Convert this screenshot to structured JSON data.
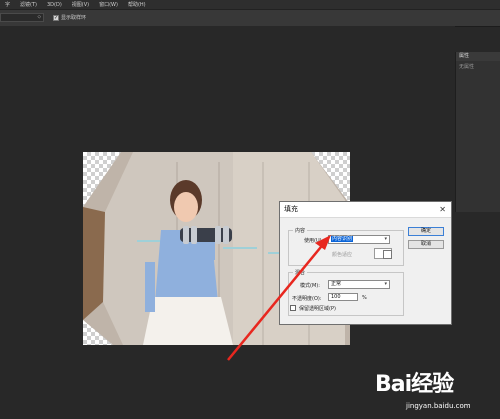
{
  "menu": [
    "字",
    "滤镜(T)",
    "3D(D)",
    "视图(V)",
    "窗口(W)",
    "帮助(H)"
  ],
  "options": {
    "show_sampling_ring": "显示取样环"
  },
  "panel": {
    "title": "属性",
    "subtitle": "无属性"
  },
  "dialog": {
    "title": "填充",
    "content_group": "内容",
    "use_label": "使用(U):",
    "use_value": "内容识别",
    "color_adapt_label": "颜色适应",
    "blend_group": "混合",
    "mode_label": "模式(M):",
    "mode_value": "正常",
    "opacity_label": "不透明度(O):",
    "opacity_value": "100",
    "opacity_unit": "%",
    "preserve_label": "保留透明区域(P)",
    "ok": "确定",
    "cancel": "取消"
  },
  "watermark": {
    "brand": "Bai经验",
    "url": "jingyan.baidu.com"
  },
  "colors": {
    "background": "#282828",
    "arrow": "#e8271f",
    "selection": "#0a64d8"
  }
}
